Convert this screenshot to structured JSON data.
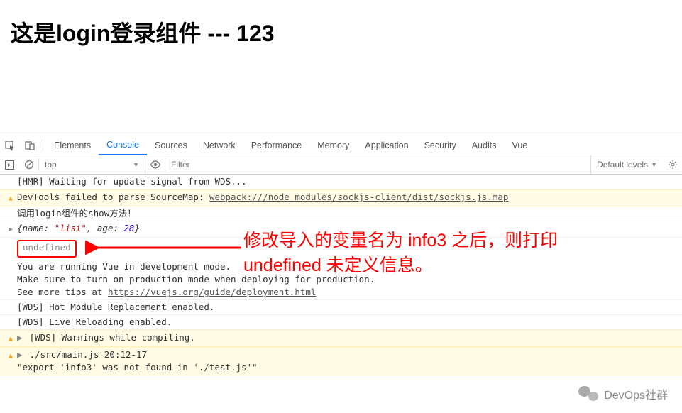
{
  "heading": "这是login登录组件 --- 123",
  "tabs": {
    "elements": "Elements",
    "console": "Console",
    "sources": "Sources",
    "network": "Network",
    "performance": "Performance",
    "memory": "Memory",
    "application": "Application",
    "security": "Security",
    "audits": "Audits",
    "vue": "Vue"
  },
  "filterbar": {
    "context": "top",
    "filter_placeholder": "Filter",
    "levels": "Default levels"
  },
  "console": {
    "hmr": "[HMR] Waiting for update signal from WDS...",
    "devtools_prefix": "DevTools failed to parse SourceMap: ",
    "devtools_link": "webpack:///node_modules/sockjs-client/dist/sockjs.js.map",
    "login_show": "调用login组件的show方法！",
    "obj_name_key": "{name: ",
    "obj_name_val": "\"lisi\"",
    "obj_age_key": ", age: ",
    "obj_age_val": "28",
    "obj_close": "}",
    "undefined_text": "undefined",
    "vue_dev_1": "You are running Vue in development mode.",
    "vue_dev_2": "Make sure to turn on production mode when deploying for production.",
    "vue_dev_3_prefix": "See more tips at ",
    "vue_dev_3_link": "https://vuejs.org/guide/deployment.html",
    "wds_hmr": "[WDS] Hot Module Replacement enabled.",
    "wds_live": "[WDS] Live Reloading enabled.",
    "wds_warn": "[WDS] Warnings while compiling.",
    "src_loc": "./src/main.js 20:12-17",
    "src_msg": "\"export 'info3' was not found in './test.js'\""
  },
  "annotation": {
    "line1": "修改导入的变量名为 info3 之后，则打印",
    "line2": "undefined 未定义信息。"
  },
  "watermark": "DevOps社群"
}
